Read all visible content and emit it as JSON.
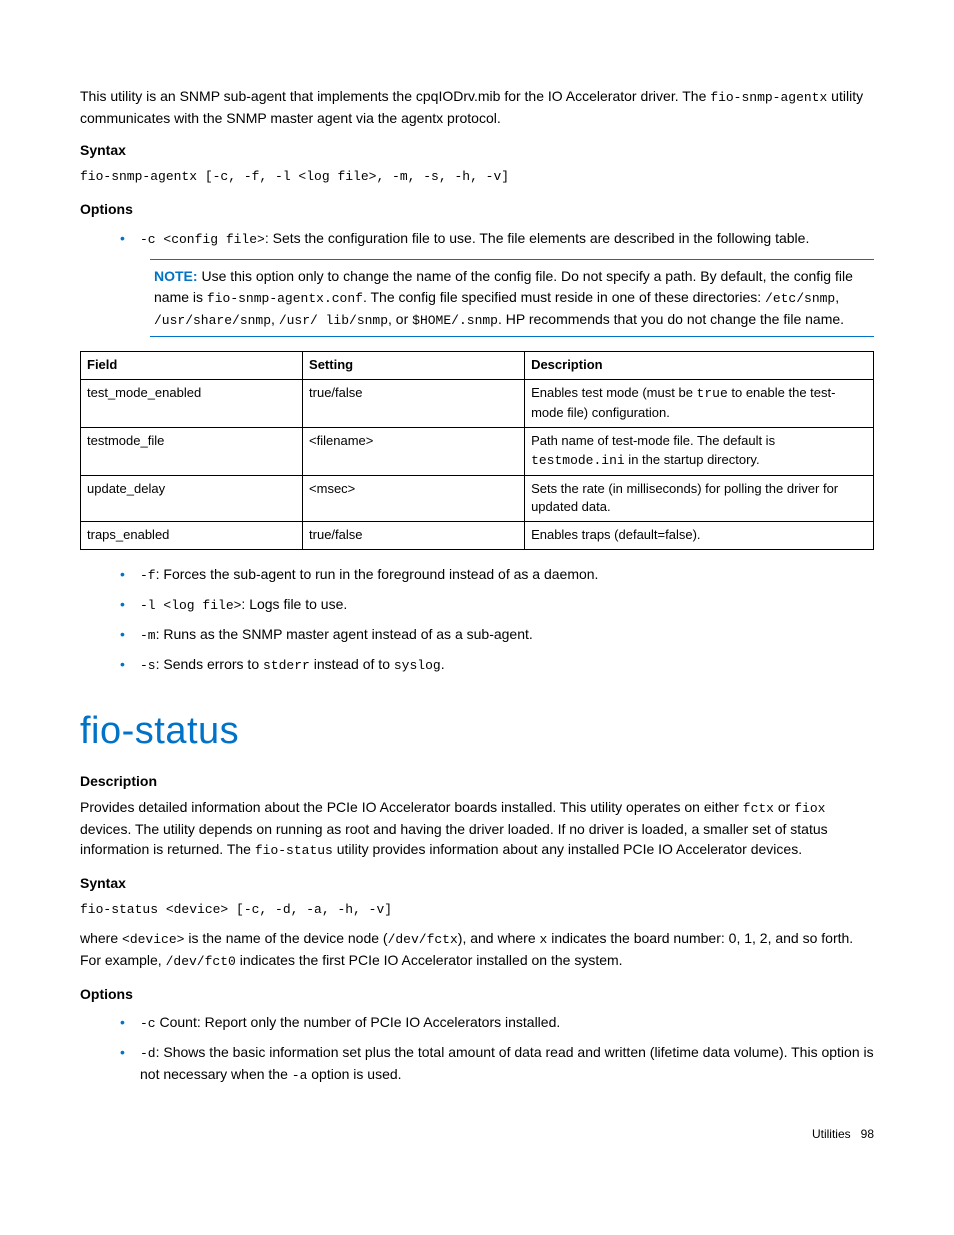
{
  "intro": {
    "p1_a": "This utility is an SNMP sub-agent that implements the cpqIODrv.mib for the IO Accelerator driver. The ",
    "p1_code": "fio-snmp-agentx",
    "p1_b": " utility communicates with the SNMP master agent via the agentx protocol."
  },
  "syntax1_label": "Syntax",
  "syntax1_code": "fio-snmp-agentx [-c, -f, -l <log file>, -m, -s, -h, -v]",
  "options_label": "Options",
  "opt_c_code": "-c <config file>",
  "opt_c_text": ": Sets the configuration file to use. The file elements are described in the following table.",
  "note": {
    "label": "NOTE:",
    "t1": "  Use this option only to change the name of the config file. Do not specify a path. By default, the config file name is ",
    "c1": "fio-snmp-agentx.conf",
    "t2": ". The config file specified must reside in one of these directories: ",
    "c2": "/etc/snmp",
    "t2b": ", ",
    "c3": "/usr/share/snmp",
    "t2c": ", ",
    "c4": "/usr/ lib/snmp",
    "t2d": ", or ",
    "c5": "$HOME/.snmp",
    "t3": ". HP recommends that you do not change the file name."
  },
  "table": {
    "headers": {
      "field": "Field",
      "setting": "Setting",
      "description": "Description"
    },
    "rows": [
      {
        "field": "test_mode_enabled",
        "setting": "true/false",
        "desc_a": "Enables test mode (must be ",
        "desc_code": "true",
        "desc_b": " to enable the test-mode file) configuration."
      },
      {
        "field": "testmode_file",
        "setting": "<filename>",
        "desc_a": "Path name of test-mode file. The default is ",
        "desc_code": "testmode.ini",
        "desc_b": " in the startup directory."
      },
      {
        "field": "update_delay",
        "setting": "<msec>",
        "desc_a": "Sets the rate (in milliseconds) for polling the driver for updated data.",
        "desc_code": "",
        "desc_b": ""
      },
      {
        "field": "traps_enabled",
        "setting": "true/false",
        "desc_a": "Enables traps (default=false).",
        "desc_code": "",
        "desc_b": ""
      }
    ]
  },
  "opts2": {
    "f_code": "-f",
    "f_text": ": Forces the sub-agent to run in the foreground instead of as a daemon.",
    "l_code": "-l <log file>",
    "l_text": ": Logs file to use.",
    "m_code": "-m",
    "m_text": ": Runs as the SNMP master agent instead of as a sub-agent.",
    "s_code": "-s",
    "s_text_a": ": Sends errors to ",
    "s_code2": "stderr",
    "s_text_b": " instead of to ",
    "s_code3": "syslog",
    "s_text_c": "."
  },
  "section2_title": "fio-status",
  "desc_label": "Description",
  "desc_p": {
    "t1": "Provides detailed information about the PCIe IO Accelerator boards installed. This utility operates on either ",
    "c1": "fctx",
    "t2": " or ",
    "c2": "fiox",
    "t3": " devices. The utility depends on running as root and having the driver loaded. If no driver is loaded, a smaller set of status information is returned. The ",
    "c3": "fio-status",
    "t4": " utility provides information about any installed PCIe IO Accelerator devices."
  },
  "syntax2_label": "Syntax",
  "syntax2_code": "fio-status <device> [-c, -d, -a, -h, -v]",
  "where_p": {
    "t1": "where ",
    "c1": "<device>",
    "t2": " is the name of the device node (",
    "c2": "/dev/fctx",
    "t3": "), and where ",
    "c3": "x",
    "t4": " indicates the board number: 0, 1, 2, and so forth. For example, ",
    "c4": "/dev/fct0",
    "t5": " indicates the first PCIe IO Accelerator installed on the system."
  },
  "options2_label": "Options",
  "opts3": {
    "c_code": "-c",
    "c_text": " Count: Report only the number of PCIe IO Accelerators installed.",
    "d_code": "-d",
    "d_text_a": ":  Shows the basic information set plus the total amount of data read and written (lifetime data volume). This option is not necessary when the ",
    "d_code2": "-a",
    "d_text_b": "  option is used."
  },
  "footer": {
    "label": "Utilities",
    "page": "98"
  }
}
